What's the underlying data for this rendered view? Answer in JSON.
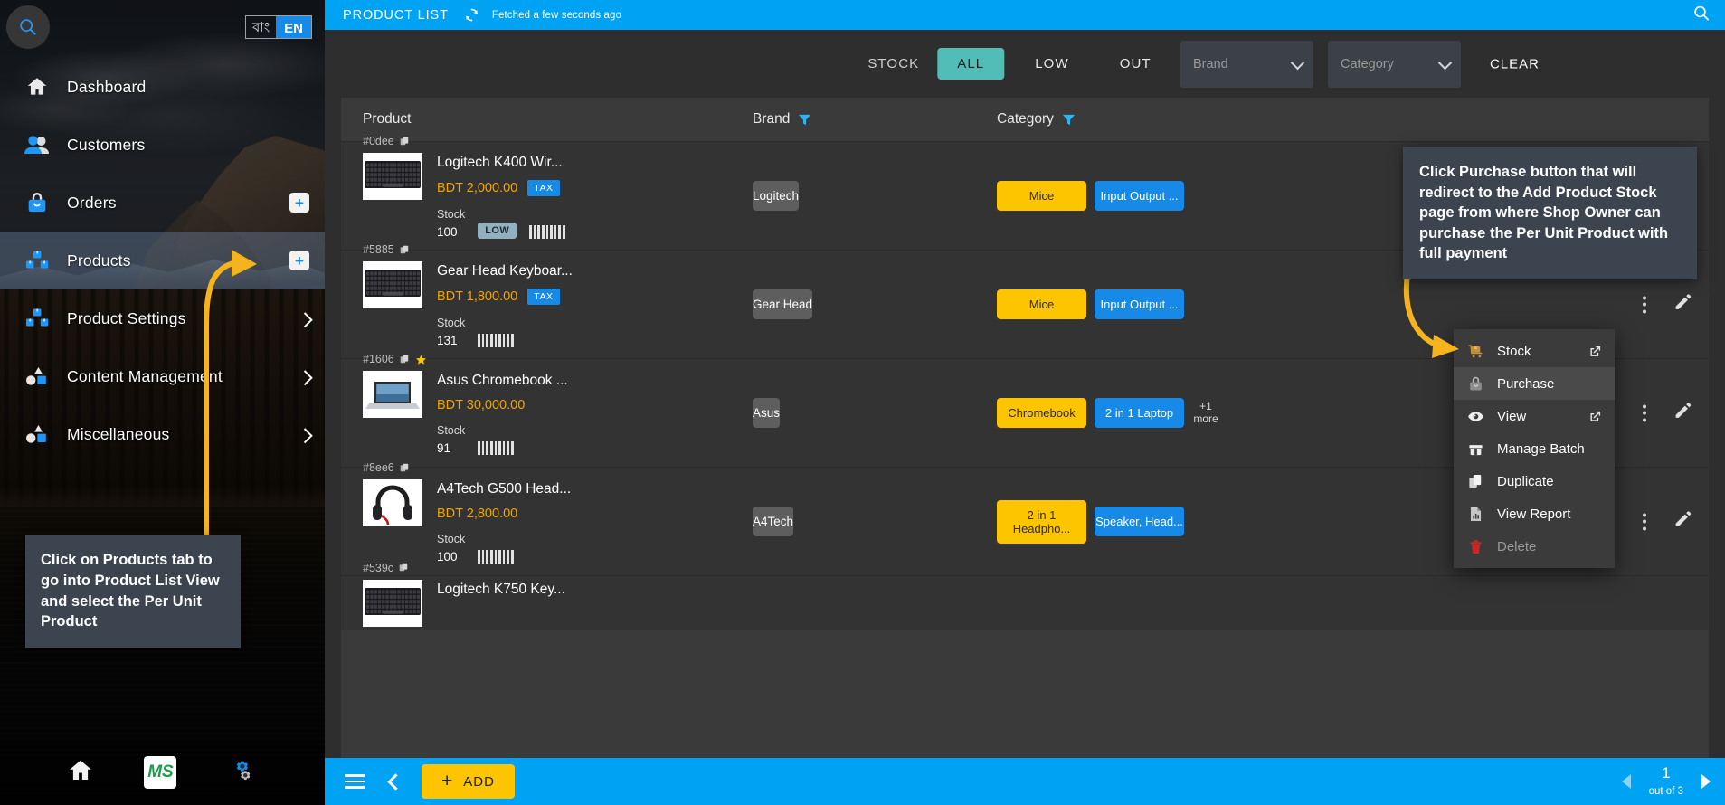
{
  "sidebar": {
    "search_icon": "search-icon",
    "lang": {
      "bn": "বাং",
      "en": "EN"
    },
    "items": [
      {
        "label": "Dashboard",
        "icon": "home-icon",
        "badge": "",
        "chevron": false,
        "active": false
      },
      {
        "label": "Customers",
        "icon": "customers-icon",
        "badge": "",
        "chevron": false,
        "active": false
      },
      {
        "label": "Orders",
        "icon": "orders-bag-icon",
        "badge": "+",
        "chevron": false,
        "active": false
      },
      {
        "label": "Products",
        "icon": "products-boxes-icon",
        "badge": "+",
        "chevron": false,
        "active": true
      },
      {
        "label": "Product Settings",
        "icon": "products-boxes-icon",
        "badge": "",
        "chevron": true,
        "active": false
      },
      {
        "label": "Content Management",
        "icon": "shapes-icon",
        "badge": "",
        "chevron": true,
        "active": false
      },
      {
        "label": "Miscellaneous",
        "icon": "shapes-icon",
        "badge": "",
        "chevron": true,
        "active": false
      }
    ],
    "tooltip": "Click on Products tab to go into Product List View and select the Per Unit Product",
    "bottom": {
      "home_icon": "home-icon",
      "logo_text": "MS",
      "settings_icon": "gears-icon"
    }
  },
  "topbar": {
    "title": "PRODUCT LIST",
    "refresh_icon": "refresh-icon",
    "fetched": "Fetched a few seconds ago",
    "search_icon": "search-icon"
  },
  "filters": {
    "stock_label": "STOCK",
    "segments": [
      {
        "label": "ALL",
        "active": true
      },
      {
        "label": "LOW",
        "active": false
      },
      {
        "label": "OUT",
        "active": false
      }
    ],
    "brand_placeholder": "Brand",
    "category_placeholder": "Category",
    "clear_label": "CLEAR"
  },
  "table": {
    "columns": {
      "product": "Product",
      "brand": "Brand",
      "category": "Category"
    },
    "rows": [
      {
        "id": "#0dee",
        "name": "Logitech K400 Wir...",
        "price": "BDT 2,000.00",
        "tax": "TAX",
        "stock_label": "Stock",
        "stock_value": "100",
        "low_badge": "LOW",
        "brand": "Logitech",
        "categories": [
          "Mice",
          "Input Output ..."
        ],
        "more": "",
        "starred": false,
        "thumb": "keyboard"
      },
      {
        "id": "#5885",
        "name": "Gear Head Keyboar...",
        "price": "BDT 1,800.00",
        "tax": "TAX",
        "stock_label": "Stock",
        "stock_value": "131",
        "low_badge": "",
        "brand": "Gear Head",
        "categories": [
          "Mice",
          "Input Output ..."
        ],
        "more": "",
        "starred": false,
        "thumb": "keyboard"
      },
      {
        "id": "#1606",
        "name": "Asus Chromebook ...",
        "price": "BDT 30,000.00",
        "tax": "",
        "stock_label": "Stock",
        "stock_value": "91",
        "low_badge": "",
        "brand": "Asus",
        "categories": [
          "Chromebook",
          "2 in 1 Laptop"
        ],
        "more": "+1 more",
        "starred": true,
        "thumb": "laptop"
      },
      {
        "id": "#8ee6",
        "name": "A4Tech G500 Head...",
        "price": "BDT 2,800.00",
        "tax": "",
        "stock_label": "Stock",
        "stock_value": "100",
        "low_badge": "",
        "brand": "A4Tech",
        "categories": [
          "2 in 1 Headpho...",
          "Speaker, Head..."
        ],
        "more": "",
        "starred": false,
        "thumb": "headset"
      },
      {
        "id": "#539c",
        "name": "Logitech K750 Key...",
        "price": "",
        "tax": "",
        "stock_label": "",
        "stock_value": "",
        "low_badge": "",
        "brand": "",
        "categories": [],
        "more": "",
        "starred": false,
        "thumb": "keyboard"
      }
    ]
  },
  "context_menu": {
    "items": [
      {
        "label": "Stock",
        "icon": "stock-cart-icon",
        "external": true,
        "highlighted": false,
        "disabled": false
      },
      {
        "label": "Purchase",
        "icon": "purchase-bag-icon",
        "external": false,
        "highlighted": true,
        "disabled": false
      },
      {
        "label": "View",
        "icon": "eye-icon",
        "external": true,
        "highlighted": false,
        "disabled": false
      },
      {
        "label": "Manage Batch",
        "icon": "batch-box-icon",
        "external": false,
        "highlighted": false,
        "disabled": false
      },
      {
        "label": "Duplicate",
        "icon": "duplicate-icon",
        "external": false,
        "highlighted": false,
        "disabled": false
      },
      {
        "label": "View Report",
        "icon": "report-chart-icon",
        "external": false,
        "highlighted": false,
        "disabled": false
      },
      {
        "label": "Delete",
        "icon": "trash-icon",
        "external": false,
        "highlighted": false,
        "disabled": true
      }
    ]
  },
  "annotation": "Click Purchase button that will redirect to the Add Product Stock page from where Shop Owner can purchase the Per Unit Product with full payment",
  "bottombar": {
    "menu_icon": "hamburger-icon",
    "back_icon": "chevron-left-icon",
    "add_label": "ADD",
    "page_number": "1",
    "page_total": "out of 3"
  },
  "colors": {
    "brand_blue": "#00a2f3",
    "accent_yellow": "#fdc500",
    "teal": "#52bdb7",
    "price_orange": "#f0a500",
    "tooltip_bg": "#3c4450",
    "arrow_yellow": "#f5b41d"
  }
}
